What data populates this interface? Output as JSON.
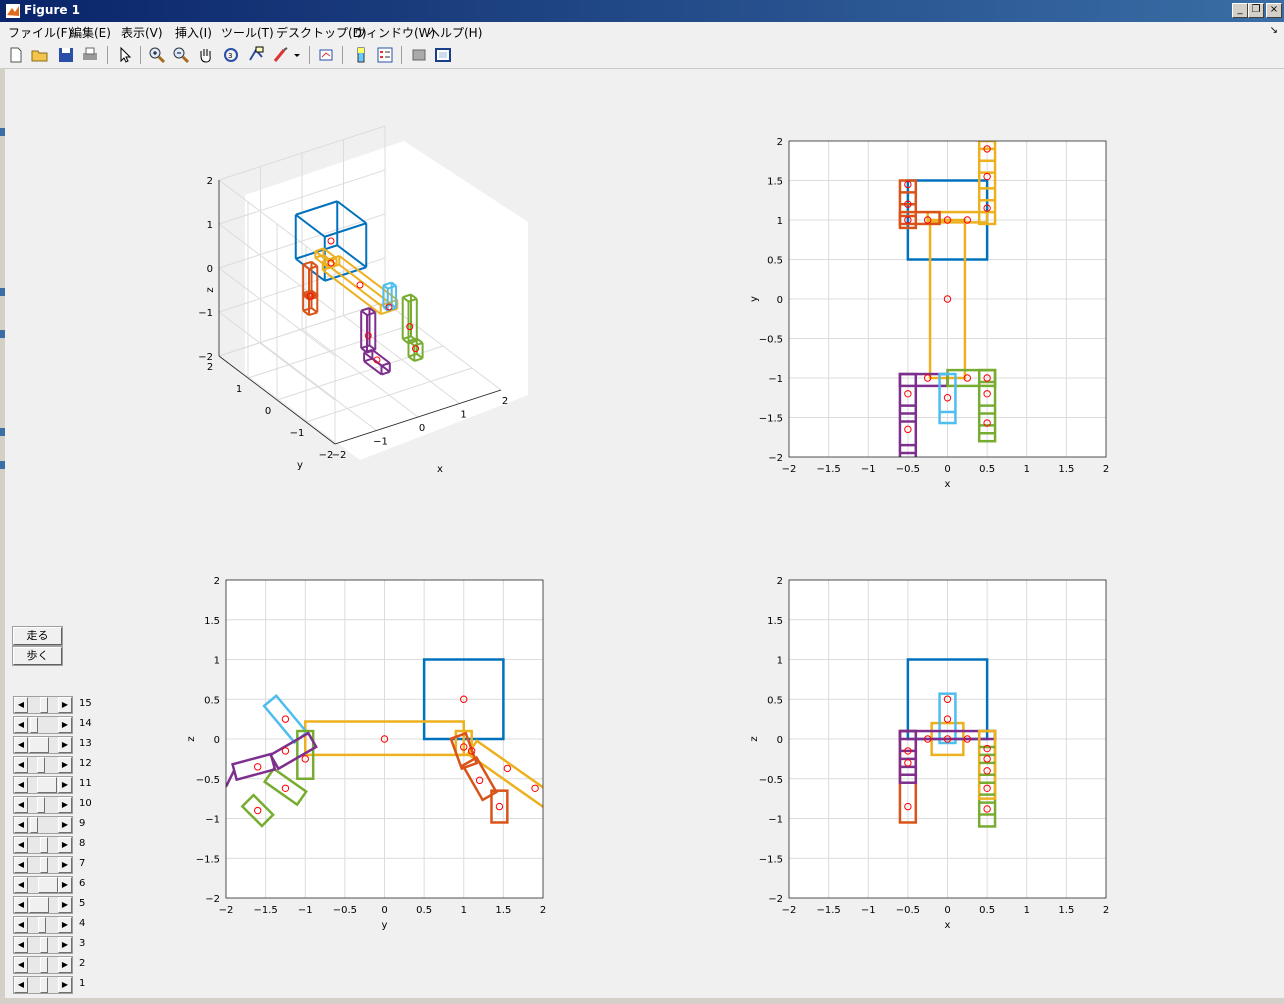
{
  "window": {
    "title": "Figure 1",
    "controls": [
      "_",
      "❐",
      "×"
    ]
  },
  "menu": [
    "ファイル(F)",
    "編集(E)",
    "表示(V)",
    "挿入(I)",
    "ツール(T)",
    "デスクトップ(D)",
    "ウィンドウ(W)",
    "ヘルプ(H)"
  ],
  "toolbar_icons": [
    "new-figure-icon",
    "open-file-icon",
    "save-icon",
    "print-icon",
    "pointer-icon",
    "zoom-in-icon",
    "zoom-out-icon",
    "pan-icon",
    "rotate-3d-icon",
    "data-cursor-icon",
    "brush-icon",
    "brush-dropdown-icon",
    "link-plot-icon",
    "colorbar-icon",
    "legend-icon",
    "hide-plot-tools-icon",
    "show-plot-tools-icon"
  ],
  "buttons": {
    "run": "走る",
    "walk": "歩く"
  },
  "sliders": [
    {
      "label": "15",
      "value": 0.55
    },
    {
      "label": "14",
      "value": 0.1
    },
    {
      "label": "13",
      "value": 0.05
    },
    {
      "label": "12",
      "value": 0.4
    },
    {
      "label": "11",
      "value": 0.4
    },
    {
      "label": "10",
      "value": 0.4
    },
    {
      "label": "9",
      "value": 0.1
    },
    {
      "label": "8",
      "value": 0.55
    },
    {
      "label": "7",
      "value": 0.55
    },
    {
      "label": "6",
      "value": 0.45
    },
    {
      "label": "5",
      "value": 0.05
    },
    {
      "label": "4",
      "value": 0.45
    },
    {
      "label": "3",
      "value": 0.55
    },
    {
      "label": "2",
      "value": 0.55
    },
    {
      "label": "1",
      "value": 0.55
    }
  ],
  "plots": {
    "view3d": {
      "xlabel": "x",
      "ylabel": "y",
      "zlabel": "z",
      "ticks": [
        "−2",
        "−1",
        "0",
        "1",
        "2"
      ]
    },
    "xy": {
      "xlabel": "x",
      "ylabel": "y",
      "ticks": [
        "−2",
        "−1.5",
        "−1",
        "−0.5",
        "0",
        "0.5",
        "1",
        "1.5",
        "2"
      ]
    },
    "yz": {
      "xlabel": "y",
      "ylabel": "z",
      "ticks": [
        "−2",
        "−1.5",
        "−1",
        "−0.5",
        "0",
        "0.5",
        "1",
        "1.5",
        "2"
      ]
    },
    "xz": {
      "xlabel": "x",
      "ylabel": "z",
      "ticks": [
        "−2",
        "−1.5",
        "−1",
        "−0.5",
        "0",
        "0.5",
        "1",
        "1.5",
        "2"
      ]
    }
  },
  "colors": {
    "body": "#0072bd",
    "leg_orange": "#d95319",
    "torso_yellow": "#edb120",
    "leg_purple": "#7e2f8e",
    "leg_green": "#77ac30",
    "head_cyan": "#4dbeee",
    "marker": "#ff0000"
  }
}
